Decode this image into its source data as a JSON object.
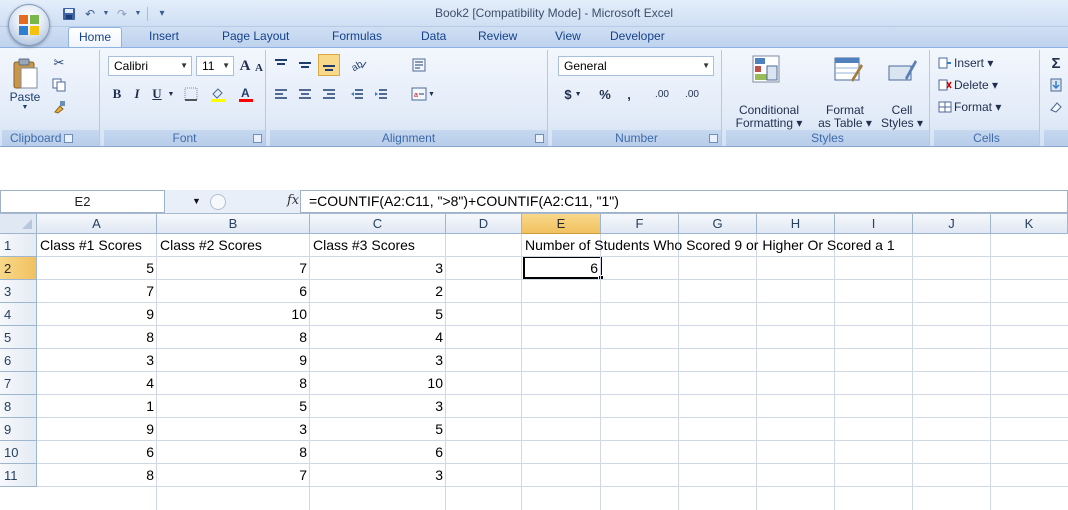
{
  "window": {
    "title": "Book2  [Compatibility Mode] - Microsoft Excel"
  },
  "tabs": [
    "Home",
    "Insert",
    "Page Layout",
    "Formulas",
    "Data",
    "Review",
    "View",
    "Developer"
  ],
  "active_tab": "Home",
  "ribbon": {
    "clipboard": {
      "label": "Clipboard",
      "paste": "Paste"
    },
    "font": {
      "label": "Font",
      "name": "Calibri",
      "size": "11",
      "bold": "B",
      "italic": "I",
      "underline": "U",
      "grow": "A",
      "shrink": "A"
    },
    "alignment": {
      "label": "Alignment"
    },
    "number": {
      "label": "Number",
      "format": "General",
      "currency": "$",
      "percent": "%",
      "comma": ",",
      "inc_decimal": ".00",
      "dec_decimal": ".00"
    },
    "styles": {
      "label": "Styles",
      "conditional_line1": "Conditional",
      "conditional_line2": "Formatting ▾",
      "format_table_line1": "Format",
      "format_table_line2": "as Table ▾",
      "cell_styles_line1": "Cell",
      "cell_styles_line2": "Styles ▾"
    },
    "cells": {
      "label": "Cells",
      "insert": "Insert ▾",
      "delete": "Delete ▾",
      "format": "Format ▾"
    },
    "editing": {
      "sigma": "Σ"
    }
  },
  "formula_bar": {
    "name_box": "E2",
    "fx": "fx",
    "formula": "=COUNTIF(A2:C11, \">8\")+COUNTIF(A2:C11, \"1\")"
  },
  "grid": {
    "columns": [
      "A",
      "B",
      "C",
      "D",
      "E",
      "F",
      "G",
      "H",
      "I",
      "J",
      "K"
    ],
    "selected_column": "E",
    "rows": [
      "1",
      "2",
      "3",
      "4",
      "5",
      "6",
      "7",
      "8",
      "9",
      "10",
      "11"
    ],
    "selected_row": "2",
    "headers": {
      "A1": "Class #1 Scores",
      "B1": "Class #2 Scores",
      "C1": "Class #3 Scores",
      "E1": "Number of Students Who Scored 9 or Higher Or Scored a 1"
    },
    "data": [
      [
        "5",
        "7",
        "3"
      ],
      [
        "7",
        "6",
        "2"
      ],
      [
        "9",
        "10",
        "5"
      ],
      [
        "8",
        "8",
        "4"
      ],
      [
        "3",
        "9",
        "3"
      ],
      [
        "4",
        "8",
        "10"
      ],
      [
        "1",
        "5",
        "3"
      ],
      [
        "9",
        "3",
        "5"
      ],
      [
        "6",
        "8",
        "6"
      ],
      [
        "8",
        "7",
        "3"
      ]
    ],
    "E2": "6"
  }
}
